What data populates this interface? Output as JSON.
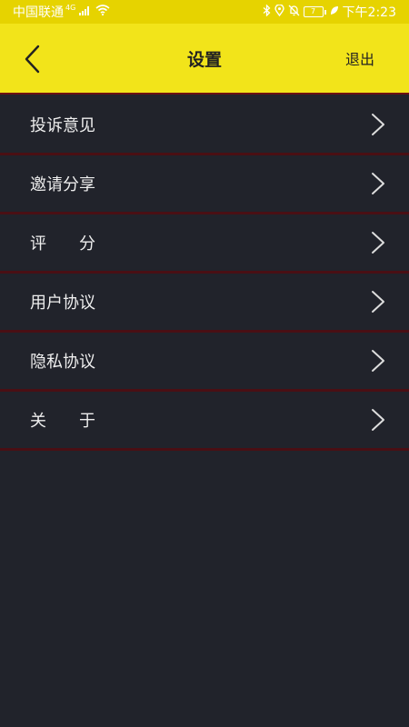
{
  "status_bar": {
    "carrier": "中国联通",
    "network": "4G",
    "battery": "7",
    "time": "下午2:23"
  },
  "header": {
    "title": "设置",
    "logout_label": "退出"
  },
  "settings": {
    "items": [
      {
        "label": "投诉意见"
      },
      {
        "label": "邀请分享"
      },
      {
        "label": "评　　分"
      },
      {
        "label": "用户协议"
      },
      {
        "label": "隐私协议"
      },
      {
        "label": "关　　于"
      }
    ]
  },
  "colors": {
    "status_bar_bg": "#e6d300",
    "header_bg": "#f2e41a",
    "list_bg": "#21232b",
    "divider": "#4a0f14",
    "text": "#eeeeee"
  },
  "icons": {
    "back": "chevron-left-icon",
    "item_arrow": "chevron-right-icon",
    "signal": "signal-icon",
    "wifi": "wifi-icon",
    "bluetooth": "bluetooth-icon",
    "location": "location-icon",
    "mute": "bell-off-icon",
    "battery": "battery-icon",
    "leaf": "leaf-icon"
  }
}
